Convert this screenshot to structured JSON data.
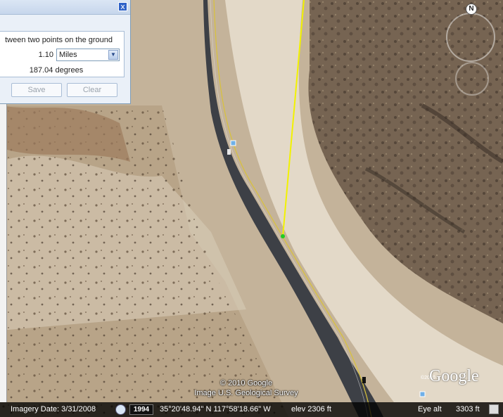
{
  "panel": {
    "close_glyph": "x",
    "description": "tween two points on the ground",
    "distance_value": "1.10",
    "unit_selected": "Miles",
    "heading": "187.04 degrees",
    "save_label": "Save",
    "clear_label": "Clear"
  },
  "map": {
    "copyright_line1": "© 2010 Google",
    "copyright_line2": "Image U.S. Geological Survey",
    "google_logo": "Google",
    "google_small": "©2010",
    "north_label": "N",
    "measure_line_color": "#f2f200",
    "measure_point_color": "#22cc22"
  },
  "status": {
    "imagery_date": "Imagery Date: 3/31/2008",
    "year": "1994",
    "coordinates": "35°20'48.94\" N 117°58'18.66\" W",
    "elevation": "elev  2306 ft",
    "eye_alt_label": "Eye alt",
    "eye_alt_value": "3303 ft"
  }
}
